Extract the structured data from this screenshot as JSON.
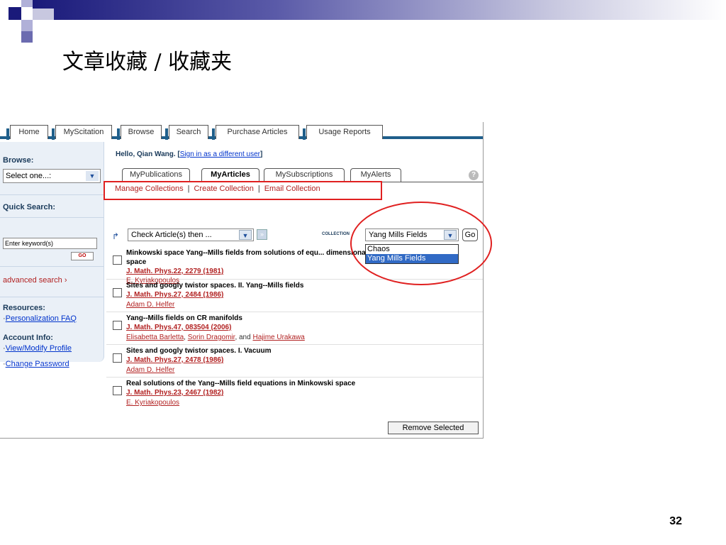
{
  "slide": {
    "title": "文章收藏 / 收藏夹",
    "number": "32"
  },
  "nav": {
    "tabs": [
      "Home",
      "MyScitation",
      "Browse",
      "Search",
      "Purchase Articles",
      "Usage Reports"
    ]
  },
  "sidebar": {
    "browse_label": "Browse:",
    "browse_value": "Select one...:",
    "quick_search_label": "Quick Search:",
    "search_placeholder": "Enter keyword(s)",
    "go_label": "GO",
    "advanced_search": "advanced search",
    "resources_label": "Resources:",
    "resources": [
      "Personalization FAQ"
    ],
    "account_label": "Account Info:",
    "account": [
      "View/Modify Profile",
      "Change Password"
    ]
  },
  "content": {
    "greeting": "Hello, Qian Wang.",
    "sign_in_link": "Sign in as a different user",
    "tabs": [
      "MyPublications",
      "MyArticles",
      "MySubscriptions",
      "MyAlerts"
    ],
    "actions": [
      "Manage Collections",
      "Create Collection",
      "Email Collection"
    ],
    "action_select": "Check Article(s) then ...",
    "collection_label": "COLLECTION",
    "collection_value": "Yang Mills Fields",
    "go_label": "Go",
    "collection_options": [
      "Chaos",
      "Yang Mills Fields"
    ],
    "remove_label": "Remove Selected"
  },
  "articles": [
    {
      "title": "Minkowski space Yang--Mills fields from solutions of equ... dimensional Euclidean space",
      "cite": "J. Math. Phys.22, 2279 (1981)",
      "authors": "E. Kyriakopoulos"
    },
    {
      "title": "Sites and googly twistor spaces. II. Yang--Mills fields",
      "cite": "J. Math. Phys.27, 2484 (1986)",
      "authors": "Adam D. Helfer"
    },
    {
      "title": "Yang--Mills fields on CR manifolds",
      "cite": "J. Math. Phys.47, 083504 (2006)",
      "authors": [
        "Elisabetta Barletta",
        "Sorin Dragomir",
        "Hajime Urakawa"
      ]
    },
    {
      "title": "Sites and googly twistor spaces. I. Vacuum",
      "cite": "J. Math. Phys.27, 2478 (1986)",
      "authors": "Adam D. Helfer"
    },
    {
      "title": "Real solutions of the Yang--Mills field equations in Minkowski space",
      "cite": "J. Math. Phys.23, 2467 (1982)",
      "authors": "E. Kyriakopoulos"
    }
  ]
}
